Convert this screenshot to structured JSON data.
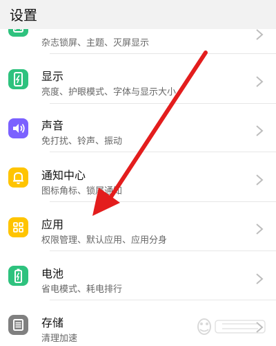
{
  "header": {
    "title": "设置"
  },
  "colors": {
    "green": "#2ec27e",
    "purple": "#7b61ff",
    "yellow": "#ffc400",
    "gray": "#808080",
    "arrow": "#e31d1d"
  },
  "items": [
    {
      "icon": "wallpaper-icon",
      "title": "",
      "subtitle": "杂志锁屏、主题、灭屏显示"
    },
    {
      "icon": "display-icon",
      "title": "显示",
      "subtitle": "亮度、护眼模式、字体与显示大小"
    },
    {
      "icon": "sound-icon",
      "title": "声音",
      "subtitle": "免打扰、铃声、振动"
    },
    {
      "icon": "bell-icon",
      "title": "通知中心",
      "subtitle": "图标角标、锁屏通知"
    },
    {
      "icon": "apps-grid-icon",
      "title": "应用",
      "subtitle": "权限管理、默认应用、应用分身"
    },
    {
      "icon": "battery-icon",
      "title": "电池",
      "subtitle": "省电模式、耗电排行"
    },
    {
      "icon": "storage-icon",
      "title": "存储",
      "subtitle": "清理加速"
    }
  ]
}
